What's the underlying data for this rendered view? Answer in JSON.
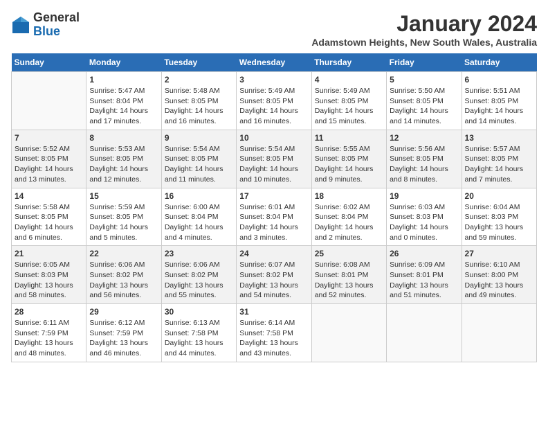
{
  "header": {
    "logo_general": "General",
    "logo_blue": "Blue",
    "month_title": "January 2024",
    "subtitle": "Adamstown Heights, New South Wales, Australia"
  },
  "weekdays": [
    "Sunday",
    "Monday",
    "Tuesday",
    "Wednesday",
    "Thursday",
    "Friday",
    "Saturday"
  ],
  "weeks": [
    [
      {
        "day": "",
        "empty": true
      },
      {
        "day": "1",
        "sunrise": "5:47 AM",
        "sunset": "8:04 PM",
        "daylight": "14 hours and 17 minutes."
      },
      {
        "day": "2",
        "sunrise": "5:48 AM",
        "sunset": "8:05 PM",
        "daylight": "14 hours and 16 minutes."
      },
      {
        "day": "3",
        "sunrise": "5:49 AM",
        "sunset": "8:05 PM",
        "daylight": "14 hours and 16 minutes."
      },
      {
        "day": "4",
        "sunrise": "5:49 AM",
        "sunset": "8:05 PM",
        "daylight": "14 hours and 15 minutes."
      },
      {
        "day": "5",
        "sunrise": "5:50 AM",
        "sunset": "8:05 PM",
        "daylight": "14 hours and 14 minutes."
      },
      {
        "day": "6",
        "sunrise": "5:51 AM",
        "sunset": "8:05 PM",
        "daylight": "14 hours and 14 minutes."
      }
    ],
    [
      {
        "day": "7",
        "sunrise": "5:52 AM",
        "sunset": "8:05 PM",
        "daylight": "14 hours and 13 minutes."
      },
      {
        "day": "8",
        "sunrise": "5:53 AM",
        "sunset": "8:05 PM",
        "daylight": "14 hours and 12 minutes."
      },
      {
        "day": "9",
        "sunrise": "5:54 AM",
        "sunset": "8:05 PM",
        "daylight": "14 hours and 11 minutes."
      },
      {
        "day": "10",
        "sunrise": "5:54 AM",
        "sunset": "8:05 PM",
        "daylight": "14 hours and 10 minutes."
      },
      {
        "day": "11",
        "sunrise": "5:55 AM",
        "sunset": "8:05 PM",
        "daylight": "14 hours and 9 minutes."
      },
      {
        "day": "12",
        "sunrise": "5:56 AM",
        "sunset": "8:05 PM",
        "daylight": "14 hours and 8 minutes."
      },
      {
        "day": "13",
        "sunrise": "5:57 AM",
        "sunset": "8:05 PM",
        "daylight": "14 hours and 7 minutes."
      }
    ],
    [
      {
        "day": "14",
        "sunrise": "5:58 AM",
        "sunset": "8:05 PM",
        "daylight": "14 hours and 6 minutes."
      },
      {
        "day": "15",
        "sunrise": "5:59 AM",
        "sunset": "8:05 PM",
        "daylight": "14 hours and 5 minutes."
      },
      {
        "day": "16",
        "sunrise": "6:00 AM",
        "sunset": "8:04 PM",
        "daylight": "14 hours and 4 minutes."
      },
      {
        "day": "17",
        "sunrise": "6:01 AM",
        "sunset": "8:04 PM",
        "daylight": "14 hours and 3 minutes."
      },
      {
        "day": "18",
        "sunrise": "6:02 AM",
        "sunset": "8:04 PM",
        "daylight": "14 hours and 2 minutes."
      },
      {
        "day": "19",
        "sunrise": "6:03 AM",
        "sunset": "8:03 PM",
        "daylight": "14 hours and 0 minutes."
      },
      {
        "day": "20",
        "sunrise": "6:04 AM",
        "sunset": "8:03 PM",
        "daylight": "13 hours and 59 minutes."
      }
    ],
    [
      {
        "day": "21",
        "sunrise": "6:05 AM",
        "sunset": "8:03 PM",
        "daylight": "13 hours and 58 minutes."
      },
      {
        "day": "22",
        "sunrise": "6:06 AM",
        "sunset": "8:02 PM",
        "daylight": "13 hours and 56 minutes."
      },
      {
        "day": "23",
        "sunrise": "6:06 AM",
        "sunset": "8:02 PM",
        "daylight": "13 hours and 55 minutes."
      },
      {
        "day": "24",
        "sunrise": "6:07 AM",
        "sunset": "8:02 PM",
        "daylight": "13 hours and 54 minutes."
      },
      {
        "day": "25",
        "sunrise": "6:08 AM",
        "sunset": "8:01 PM",
        "daylight": "13 hours and 52 minutes."
      },
      {
        "day": "26",
        "sunrise": "6:09 AM",
        "sunset": "8:01 PM",
        "daylight": "13 hours and 51 minutes."
      },
      {
        "day": "27",
        "sunrise": "6:10 AM",
        "sunset": "8:00 PM",
        "daylight": "13 hours and 49 minutes."
      }
    ],
    [
      {
        "day": "28",
        "sunrise": "6:11 AM",
        "sunset": "7:59 PM",
        "daylight": "13 hours and 48 minutes."
      },
      {
        "day": "29",
        "sunrise": "6:12 AM",
        "sunset": "7:59 PM",
        "daylight": "13 hours and 46 minutes."
      },
      {
        "day": "30",
        "sunrise": "6:13 AM",
        "sunset": "7:58 PM",
        "daylight": "13 hours and 44 minutes."
      },
      {
        "day": "31",
        "sunrise": "6:14 AM",
        "sunset": "7:58 PM",
        "daylight": "13 hours and 43 minutes."
      },
      {
        "day": "",
        "empty": true
      },
      {
        "day": "",
        "empty": true
      },
      {
        "day": "",
        "empty": true
      }
    ]
  ]
}
